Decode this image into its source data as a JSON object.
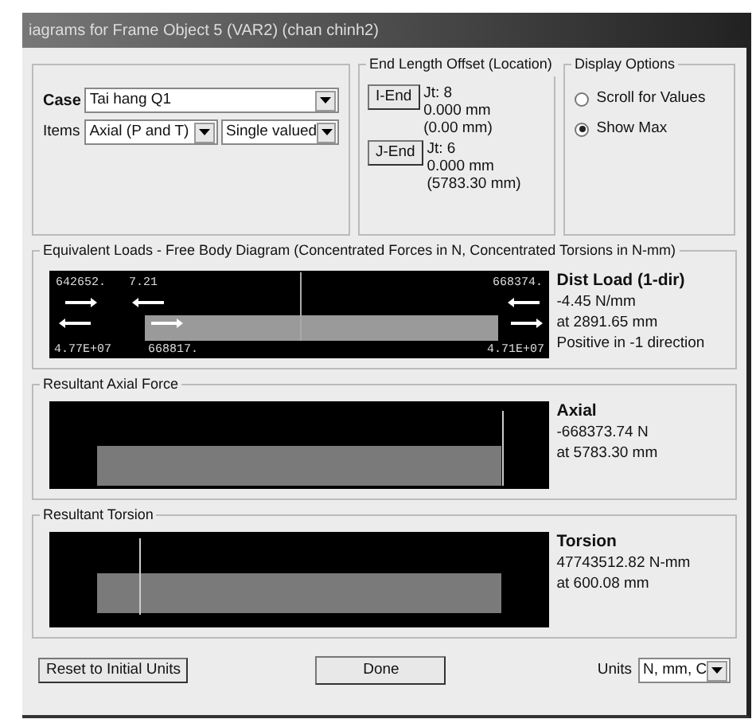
{
  "window": {
    "title": "iagrams for Frame Object 5  (VAR2) (chan chinh2)"
  },
  "case": {
    "label": "Case",
    "value": "Tai hang Q1"
  },
  "items": {
    "label": "Items",
    "value": "Axial (P and T)",
    "mode": "Single valued"
  },
  "end_offset": {
    "title": "End Length Offset (Location)",
    "ends": [
      {
        "button": "I-End",
        "joint": "Jt: 8",
        "offset": "0.000 mm",
        "location": "(0.00 mm)"
      },
      {
        "button": "J-End",
        "joint": "Jt: 6",
        "offset": "0.000 mm",
        "location": "(5783.30 mm)"
      }
    ]
  },
  "display_options": {
    "title": "Display Options",
    "options": [
      {
        "label": "Scroll for Values",
        "selected": false
      },
      {
        "label": "Show Max",
        "selected": true
      }
    ]
  },
  "panels": [
    {
      "kind": "fbd",
      "title": "Equivalent Loads - Free Body Diagram  (Concentrated Forces in N, Concentrated Torsions in N-mm)",
      "diagram_labels": [
        "642652.",
        "7.21",
        "668374.",
        "4.77E+07",
        "668817.",
        "4.71E+07"
      ],
      "info_title": "Dist Load (1-dir)",
      "info_lines": [
        "-4.45 N/mm",
        "at 2891.65 mm",
        "Positive in -1 direction"
      ]
    },
    {
      "kind": "axial",
      "title": "Resultant Axial Force",
      "info_title": "Axial",
      "info_lines": [
        "-668373.74 N",
        "at 5783.30 mm"
      ]
    },
    {
      "kind": "torsion",
      "title": "Resultant Torsion",
      "info_title": "Torsion",
      "info_lines": [
        "47743512.82 N-mm",
        "at 600.08 mm"
      ]
    }
  ],
  "buttons": {
    "reset": "Reset to Initial Units",
    "done": "Done"
  },
  "units": {
    "label": "Units",
    "value": "N, mm, C"
  }
}
